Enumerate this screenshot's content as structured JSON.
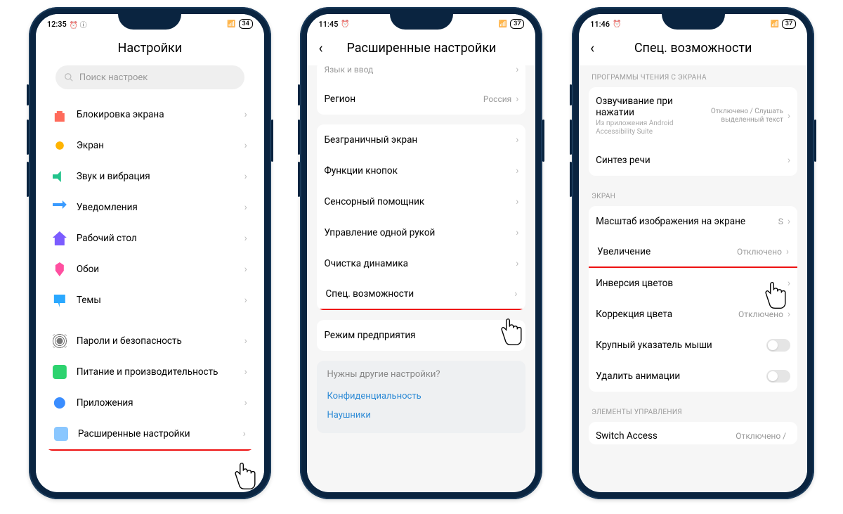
{
  "phone1": {
    "status": {
      "time": "12:35",
      "icons": "⏰ ⓘ",
      "signal": "📶",
      "battery": "34"
    },
    "title": "Настройки",
    "search_placeholder": "Поиск настроек",
    "group1": [
      {
        "icon": "ic-lock",
        "label": "Блокировка экрана"
      },
      {
        "icon": "ic-sun",
        "label": "Экран"
      },
      {
        "icon": "ic-sound",
        "label": "Звук и вибрация"
      },
      {
        "icon": "ic-notif",
        "label": "Уведомления"
      },
      {
        "icon": "ic-home",
        "label": "Рабочий стол"
      },
      {
        "icon": "ic-wall",
        "label": "Обои"
      },
      {
        "icon": "ic-theme",
        "label": "Темы"
      }
    ],
    "group2": [
      {
        "icon": "ic-finger",
        "label": "Пароли и безопасность"
      },
      {
        "icon": "ic-power",
        "label": "Питание и производительность"
      },
      {
        "icon": "ic-apps",
        "label": "Приложения"
      },
      {
        "icon": "ic-more",
        "label": "Расширенные настройки",
        "highlight": true
      }
    ]
  },
  "phone2": {
    "status": {
      "time": "11:45",
      "icons": "⏰",
      "signal": "📶",
      "battery": "37"
    },
    "title": "Расширенные настройки",
    "rows_top": [
      {
        "label": "Язык и ввод"
      },
      {
        "label": "Регион",
        "value": "Россия"
      }
    ],
    "rows_mid": [
      {
        "label": "Безграничный экран"
      },
      {
        "label": "Функции кнопок"
      },
      {
        "label": "Сенсорный помощник"
      },
      {
        "label": "Управление одной рукой"
      },
      {
        "label": "Очистка динамика"
      },
      {
        "label": "Спец. возможности",
        "highlight": true
      }
    ],
    "rows_bot": [
      {
        "label": "Режим предприятия"
      }
    ],
    "suggest": {
      "question": "Нужны другие настройки?",
      "link1": "Конфиденциальность",
      "link2": "Наушники"
    }
  },
  "phone3": {
    "status": {
      "time": "11:46",
      "icons": "⏰",
      "signal": "📶",
      "battery": "37"
    },
    "title": "Спец. возможности",
    "section1_header": "ПРОГРАММЫ ЧТЕНИЯ С ЭКРАНА",
    "section1": [
      {
        "label": "Озвучивание при нажатии",
        "sub": "Из приложения Android Accessibility Suite",
        "value": "Отключено / Слушать выделенный текст"
      },
      {
        "label": "Синтез речи"
      }
    ],
    "section2_header": "ЭКРАН",
    "section2": [
      {
        "label": "Масштаб изображения на экране",
        "value": "S"
      },
      {
        "label": "Увеличение",
        "value": "Отключено",
        "highlight": true
      },
      {
        "label": "Инверсия цветов"
      },
      {
        "label": "Коррекция цвета",
        "value": "Отключено"
      },
      {
        "label": "Крупный указатель мыши",
        "toggle": true
      },
      {
        "label": "Удалить анимации",
        "toggle": true
      }
    ],
    "section3_header": "ЭЛЕМЕНТЫ УПРАВЛЕНИЯ",
    "section3": [
      {
        "label": "Switch Access",
        "value": "Отключено /"
      }
    ]
  }
}
